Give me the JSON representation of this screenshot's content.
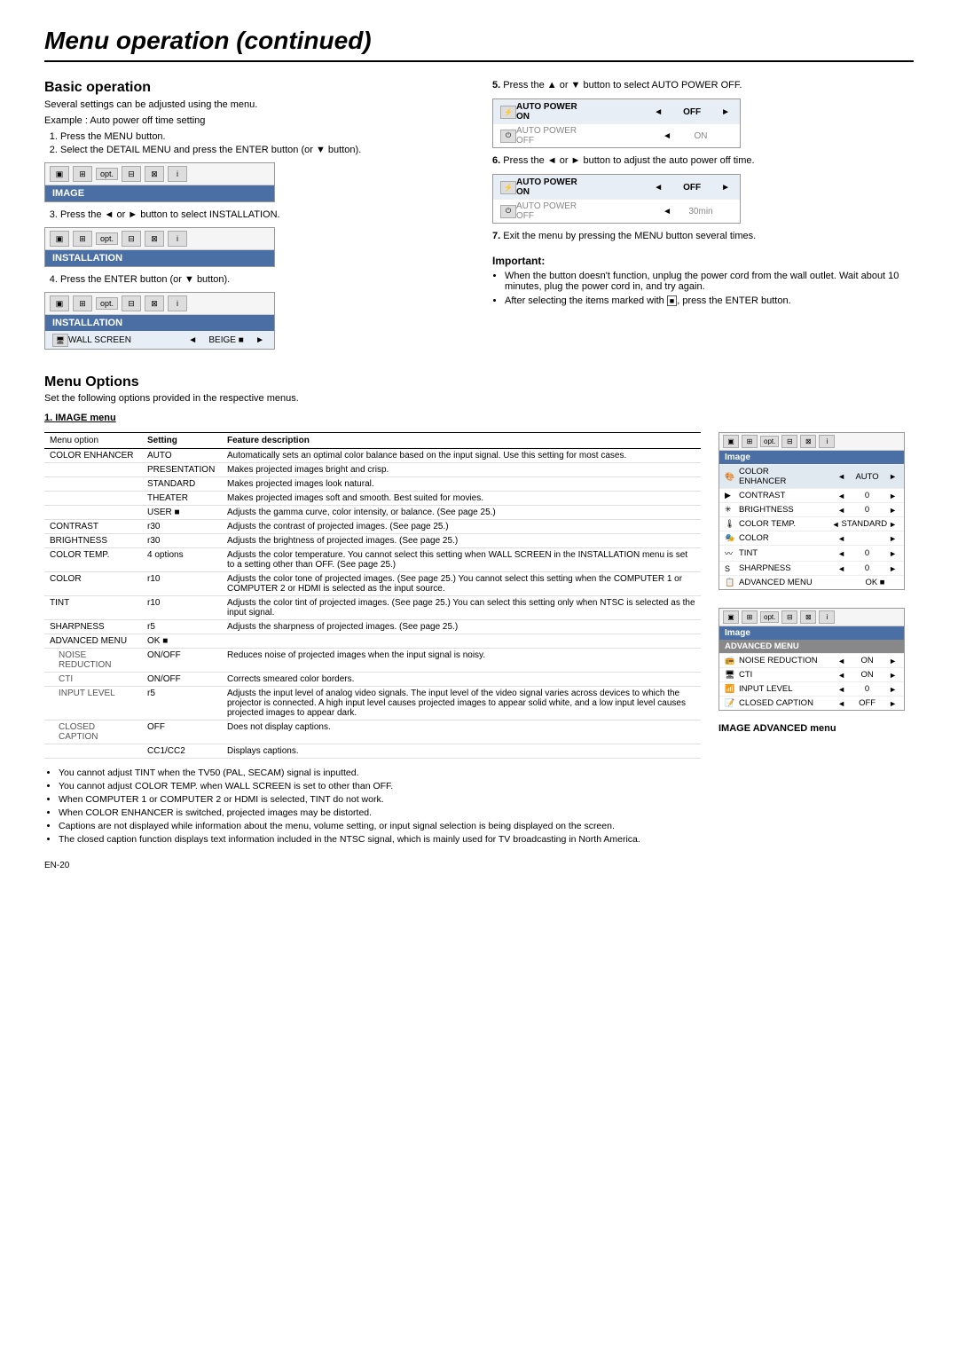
{
  "page": {
    "title": "Menu operation (continued)",
    "footer": "EN-20"
  },
  "basic_operation": {
    "title": "Basic operation",
    "subtitle": "Several settings can be adjusted using the menu.",
    "example": "Example : Auto power off time setting",
    "steps": [
      "Press the MENU button.",
      "Select the DETAIL MENU and press the ENTER button  (or ▼ button).",
      "Press the ◄ or ► button to select INSTALLATION.",
      "Press the ENTER button (or ▼ button).",
      "Press the ▲ or ▼ button to select AUTO POWER OFF.",
      "Press the ◄ or ► button to adjust the auto power off time.",
      "Exit the menu by pressing the MENU button several times."
    ]
  },
  "important": {
    "title": "Important:",
    "bullets": [
      "When the button doesn't function, unplug the power cord from the wall outlet. Wait about 10 minutes, plug the power cord in, and try again.",
      "After selecting the items marked with  , press the ENTER button."
    ]
  },
  "menu_options": {
    "title": "Menu Options",
    "subtitle": "Set the following options provided in the respective menus.",
    "image_menu_title": "1. IMAGE menu",
    "table_headers": {
      "option": "Menu option",
      "setting": "Setting",
      "description": "Feature description"
    },
    "rows": [
      {
        "option": "COLOR ENHANCER",
        "setting": "AUTO",
        "description": "Automatically sets an optimal color balance based on the input signal. Use this setting for most cases.",
        "group_start": true
      },
      {
        "option": "",
        "setting": "PRESENTATION",
        "description": "Makes projected images bright and crisp."
      },
      {
        "option": "",
        "setting": "STANDARD",
        "description": "Makes projected images look natural."
      },
      {
        "option": "",
        "setting": "THEATER",
        "description": "Makes projected images soft and smooth. Best suited for movies."
      },
      {
        "option": "",
        "setting": "USER ■",
        "description": "Adjusts the gamma curve, color intensity, or balance. (See page 25.)"
      },
      {
        "option": "CONTRAST",
        "setting": "r30",
        "description": "Adjusts the contrast of projected images. (See page 25.)",
        "group_start": true
      },
      {
        "option": "BRIGHTNESS",
        "setting": "r30",
        "description": "Adjusts the brightness of projected images. (See page 25.)",
        "group_start": true
      },
      {
        "option": "COLOR TEMP.",
        "setting": "4 options",
        "description": "Adjusts the color temperature. You cannot select this setting when WALL SCREEN in the INSTALLATION menu is set to a setting other than OFF. (See page 25.)",
        "group_start": true
      },
      {
        "option": "COLOR",
        "setting": "r10",
        "description": "Adjusts the color tone of projected images. (See page 25.) You cannot select this setting when the COMPUTER 1 or COMPUTER 2 or HDMI is selected as the input source.",
        "group_start": true
      },
      {
        "option": "TINT",
        "setting": "r10",
        "description": "Adjusts the color tint of projected images. (See page 25.) You can select this setting only when NTSC is selected as the input signal.",
        "group_start": true
      },
      {
        "option": "SHARPNESS",
        "setting": "r5",
        "description": "Adjusts the sharpness of projected images. (See page 25.)",
        "group_start": true
      },
      {
        "option": "ADVANCED MENU",
        "setting": "OK ■",
        "description": "",
        "group_start": true
      },
      {
        "option": "NOISE REDUCTION",
        "setting": "ON/OFF",
        "description": "Reduces noise of projected images when the input signal is noisy.",
        "group_start": true,
        "sub": true
      },
      {
        "option": "CTI",
        "setting": "ON/OFF",
        "description": "Corrects smeared color borders.",
        "group_start": false,
        "sub": true
      },
      {
        "option": "INPUT LEVEL",
        "setting": "r5",
        "description": "Adjusts the input level of analog video signals. The input level of the video signal varies across devices to which the projector is connected. A high input level causes projected images to appear solid white, and a low input level causes projected images to appear dark.",
        "group_start": true,
        "sub": true
      },
      {
        "option": "CLOSED CAPTION",
        "setting": "OFF",
        "description": "Does not display captions.",
        "group_start": true,
        "sub": true
      },
      {
        "option": "",
        "setting": "CC1/CC2",
        "description": "Displays captions."
      }
    ],
    "bottom_notes": [
      "You cannot adjust TINT when the TV50 (PAL, SECAM) signal is inputted.",
      "You cannot adjust COLOR TEMP. when WALL SCREEN is set to other than OFF.",
      "When COMPUTER 1 or COMPUTER 2 or HDMI is selected, TINT do not work.",
      "When COLOR ENHANCER is switched, projected images may be distorted.",
      "Captions are not displayed while information about the menu, volume setting, or input signal selection is being displayed on the screen.",
      "The closed caption function displays text information included in the NTSC signal, which is mainly used for TV broadcasting in North America."
    ]
  },
  "menu_mockups": {
    "image_menu": {
      "header": "IMAGE",
      "rows": [
        {
          "icon": "🎨",
          "label": "COLOR ENHANCER",
          "value": "AUTO"
        },
        {
          "icon": "▶",
          "label": "CONTRAST",
          "value": "0"
        },
        {
          "icon": "☀",
          "label": "BRIGHTNESS",
          "value": "0"
        },
        {
          "icon": "🌡",
          "label": "COLOR TEMP.",
          "value": "STANDARD"
        },
        {
          "icon": "🎭",
          "label": "COLOR",
          "value": ""
        },
        {
          "icon": "〰",
          "label": "TINT",
          "value": "0"
        },
        {
          "icon": "S",
          "label": "SHARPNESS",
          "value": "0"
        },
        {
          "icon": "📋",
          "label": "ADVANCED MENU",
          "value": "OK ■"
        }
      ]
    },
    "advanced_menu": {
      "header": "IMAGE",
      "adv_header": "ADVANCED MENU",
      "rows": [
        {
          "icon": "📻",
          "label": "NOISE REDUCTION",
          "value": "ON"
        },
        {
          "icon": "🖥",
          "label": "CTI",
          "value": "ON"
        },
        {
          "icon": "📶",
          "label": "INPUT LEVEL",
          "value": "0"
        },
        {
          "icon": "📝",
          "label": "CLOSED CAPTION",
          "value": "OFF"
        }
      ]
    }
  },
  "menu_boxes": {
    "image_box": {
      "header": "IMAGE",
      "label": "IMAGE"
    },
    "installation_box": {
      "header": "INSTALLATION",
      "label": "INSTALLATION"
    },
    "installation_wallscreen": {
      "header": "INSTALLATION",
      "row_label": "WALL SCREEN",
      "row_value": "BEIGE ■"
    },
    "auto_power_off1": {
      "row1_label": "AUTO POWER ON",
      "row1_value": "OFF",
      "row2_label": "AUTO POWER OFF",
      "row2_value": "ON"
    },
    "auto_power_off2": {
      "row1_label": "AUTO POWER ON",
      "row1_value": "OFF",
      "row2_label": "AUTO POWER OFF",
      "row2_value": "30min"
    }
  },
  "image_advanced_label": "IMAGE ADVANCED menu"
}
